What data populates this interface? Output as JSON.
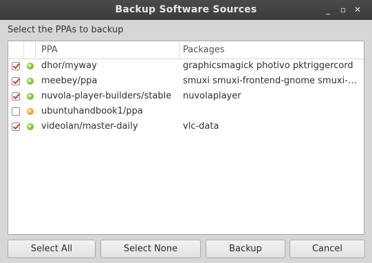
{
  "window": {
    "title": "Backup Software Sources",
    "minimize_glyph": "_",
    "maximize_glyph": "▫",
    "close_glyph": "✕"
  },
  "prompt": "Select the PPAs to backup",
  "table": {
    "columns": [
      "PPA",
      "Packages"
    ],
    "rows": [
      {
        "checked": true,
        "status": "green",
        "ppa": "dhor/myway",
        "packages": "graphicsmagick photivo pktriggercord"
      },
      {
        "checked": true,
        "status": "green",
        "ppa": "meebey/ppa",
        "packages": "smuxi smuxi-frontend-gnome smuxi-engine"
      },
      {
        "checked": true,
        "status": "green",
        "ppa": "nuvola-player-builders/stable",
        "packages": "nuvolaplayer"
      },
      {
        "checked": false,
        "status": "orange",
        "ppa": "ubuntuhandbook1/ppa",
        "packages": ""
      },
      {
        "checked": true,
        "status": "green",
        "ppa": "videolan/master-daily",
        "packages": "vlc-data"
      }
    ]
  },
  "buttons": {
    "select_all": "Select All",
    "select_none": "Select None",
    "backup": "Backup",
    "cancel": "Cancel"
  },
  "colors": {
    "green": "#7cc62a",
    "orange": "#f0a430",
    "check": "#d23b2a"
  }
}
